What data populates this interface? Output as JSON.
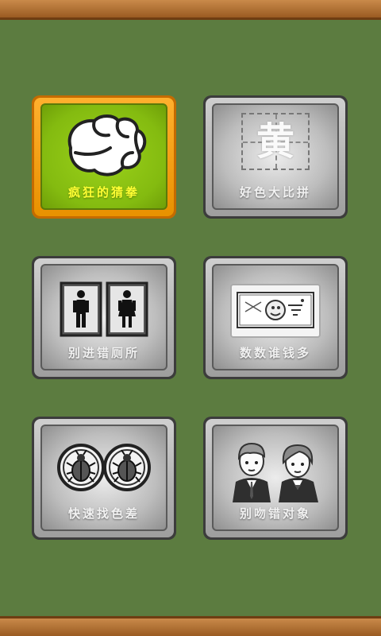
{
  "games": [
    {
      "label": "疯狂的猜拳",
      "icon": "fist-icon"
    },
    {
      "label": "好色大比拼",
      "icon": "color-character-icon",
      "glyph": "黄"
    },
    {
      "label": "别进错厕所",
      "icon": "restroom-icon"
    },
    {
      "label": "数数谁钱多",
      "icon": "banknote-icon"
    },
    {
      "label": "快速找色差",
      "icon": "beetle-coins-icon"
    },
    {
      "label": "别吻错对象",
      "icon": "couple-icon"
    }
  ],
  "colors": {
    "board": "#5c7c40",
    "frame": "#b06f30",
    "active_tile": "#8cc614",
    "active_label": "#ffff33"
  }
}
